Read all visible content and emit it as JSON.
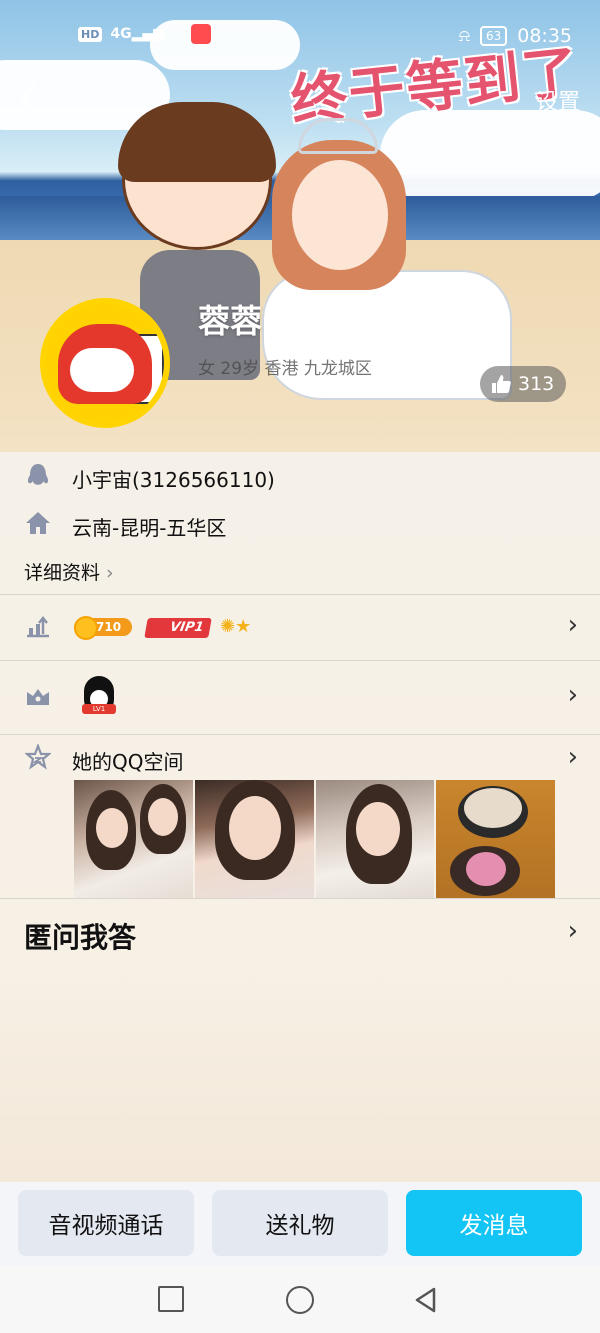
{
  "status_bar": {
    "hd": "HD",
    "network": "4G",
    "battery": "63",
    "time": "08:35"
  },
  "header": {
    "back_icon": "chevron-left-icon",
    "settings_label": "设置",
    "banner_text": "终于等到了"
  },
  "profile": {
    "nickname": "蓉蓉",
    "meta": "女 29岁 香港 九龙城区",
    "likes": "313"
  },
  "info": {
    "qq_line": "小宇宙(3126566110)",
    "location_line": "云南-昆明-五华区",
    "detail_label": "详细资料",
    "level_coin": "710",
    "vip_label": "VIP1",
    "penguin_badge": "LV1",
    "qzone_label": "她的QQ空间",
    "qa_title": "匿问我答"
  },
  "actions": {
    "call_label": "音视频通话",
    "gift_label": "送礼物",
    "message_label": "发消息"
  },
  "colors": {
    "accent": "#12c5f4",
    "secondary_button": "#e4e8f1",
    "icon_gray": "#8b93ab",
    "vip_red": "#e2383b",
    "coin_orange": "#f39a1a"
  }
}
